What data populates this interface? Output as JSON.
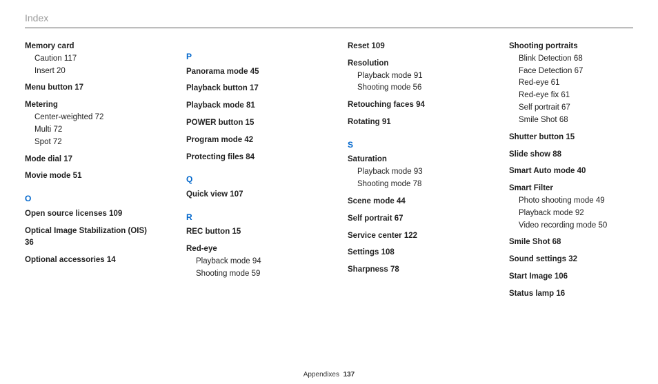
{
  "header_title": "Index",
  "footer": {
    "section": "Appendixes",
    "page": "137"
  },
  "columns": [
    [
      {
        "type": "term",
        "text": "Memory card",
        "subs": [
          {
            "text": "Caution",
            "page": "117"
          },
          {
            "text": "Insert",
            "page": "20"
          }
        ]
      },
      {
        "type": "term",
        "text": "Menu button",
        "page": "17"
      },
      {
        "type": "term",
        "text": "Metering",
        "subs": [
          {
            "text": "Center-weighted",
            "page": "72"
          },
          {
            "text": "Multi",
            "page": "72"
          },
          {
            "text": "Spot",
            "page": "72"
          }
        ]
      },
      {
        "type": "term",
        "text": "Mode dial",
        "page": "17"
      },
      {
        "type": "term",
        "text": "Movie mode",
        "page": "51"
      },
      {
        "type": "letter",
        "text": "O"
      },
      {
        "type": "term",
        "text": "Open source licenses",
        "page": "109"
      },
      {
        "type": "term",
        "text": "Optical Image Stabilization (OIS)",
        "page": "36"
      },
      {
        "type": "term",
        "text": "Optional accessories",
        "page": "14"
      }
    ],
    [
      {
        "type": "letter",
        "text": "P"
      },
      {
        "type": "term",
        "text": "Panorama mode",
        "page": "45"
      },
      {
        "type": "term",
        "text": "Playback button",
        "page": "17"
      },
      {
        "type": "term",
        "text": "Playback mode",
        "page": "81"
      },
      {
        "type": "term",
        "text": "POWER button",
        "page": "15"
      },
      {
        "type": "term",
        "text": "Program mode",
        "page": "42"
      },
      {
        "type": "term",
        "text": "Protecting files",
        "page": "84"
      },
      {
        "type": "letter",
        "text": "Q"
      },
      {
        "type": "term",
        "text": "Quick view",
        "page": "107"
      },
      {
        "type": "letter",
        "text": "R"
      },
      {
        "type": "term",
        "text": "REC button",
        "page": "15"
      },
      {
        "type": "term",
        "text": "Red-eye",
        "subs": [
          {
            "text": "Playback mode",
            "page": "94"
          },
          {
            "text": "Shooting mode",
            "page": "59"
          }
        ]
      }
    ],
    [
      {
        "type": "term",
        "text": "Reset",
        "page": "109"
      },
      {
        "type": "term",
        "text": "Resolution",
        "subs": [
          {
            "text": "Playback mode",
            "page": "91"
          },
          {
            "text": "Shooting mode",
            "page": "56"
          }
        ]
      },
      {
        "type": "term",
        "text": "Retouching faces",
        "page": "94"
      },
      {
        "type": "term",
        "text": "Rotating",
        "page": "91"
      },
      {
        "type": "letter",
        "text": "S"
      },
      {
        "type": "term",
        "text": "Saturation",
        "subs": [
          {
            "text": "Playback mode",
            "page": "93"
          },
          {
            "text": "Shooting mode",
            "page": "78"
          }
        ]
      },
      {
        "type": "term",
        "text": "Scene mode",
        "page": "44"
      },
      {
        "type": "term",
        "text": "Self portrait",
        "page": "67"
      },
      {
        "type": "term",
        "text": "Service center",
        "page": "122"
      },
      {
        "type": "term",
        "text": "Settings",
        "page": "108"
      },
      {
        "type": "term",
        "text": "Sharpness",
        "page": "78"
      }
    ],
    [
      {
        "type": "term",
        "text": "Shooting portraits",
        "subs": [
          {
            "text": "Blink Detection",
            "page": "68"
          },
          {
            "text": "Face Detection",
            "page": "67"
          },
          {
            "text": "Red-eye",
            "page": "61"
          },
          {
            "text": "Red-eye fix",
            "page": "61"
          },
          {
            "text": "Self portrait",
            "page": "67"
          },
          {
            "text": "Smile Shot",
            "page": "68"
          }
        ]
      },
      {
        "type": "term",
        "text": "Shutter button",
        "page": "15"
      },
      {
        "type": "term",
        "text": "Slide show",
        "page": "88"
      },
      {
        "type": "term",
        "text": "Smart Auto mode",
        "page": "40"
      },
      {
        "type": "term",
        "text": "Smart Filter",
        "subs": [
          {
            "text": "Photo shooting mode",
            "page": "49"
          },
          {
            "text": "Playback mode",
            "page": "92"
          },
          {
            "text": "Video recording mode",
            "page": "50"
          }
        ]
      },
      {
        "type": "term",
        "text": "Smile Shot",
        "page": "68"
      },
      {
        "type": "term",
        "text": "Sound settings",
        "page": "32"
      },
      {
        "type": "term",
        "text": "Start Image",
        "page": "106"
      },
      {
        "type": "term",
        "text": "Status lamp",
        "page": "16"
      }
    ]
  ]
}
